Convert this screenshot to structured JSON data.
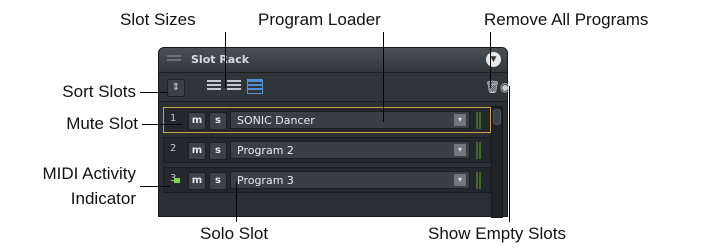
{
  "callouts": {
    "slot_sizes": "Slot Sizes",
    "program_loader": "Program Loader",
    "remove_all_programs": "Remove All Programs",
    "sort_slots": "Sort Slots",
    "mute_slot": "Mute Slot",
    "midi_activity_line1": "MIDI Activity",
    "midi_activity_line2": "Indicator",
    "solo_slot": "Solo Slot",
    "show_empty_slots": "Show Empty Slots"
  },
  "panel": {
    "title": "Slot Rack",
    "collapse_icon": "chevron-down-icon",
    "toolbar": {
      "sort_glyph": "⇕",
      "size_options": [
        "small",
        "medium",
        "large"
      ],
      "selected_size": "large",
      "trash_glyph": "🗑",
      "eye_glyph": "◉"
    },
    "slots": [
      {
        "number": "1",
        "mute": "m",
        "solo": "s",
        "program": "SONIC Dancer",
        "selected": true
      },
      {
        "number": "2",
        "mute": "m",
        "solo": "s",
        "program": "Program 2",
        "selected": false
      },
      {
        "number": "3",
        "mute": "m",
        "solo": "s",
        "program": "Program 3",
        "selected": false
      }
    ],
    "dropdown_glyph": "▾"
  },
  "colors": {
    "panel_bg": "#2b2f33",
    "selected_border": "#c9a34a",
    "active_size": "#4e8fd8",
    "midi_led": "#7bd64a"
  }
}
